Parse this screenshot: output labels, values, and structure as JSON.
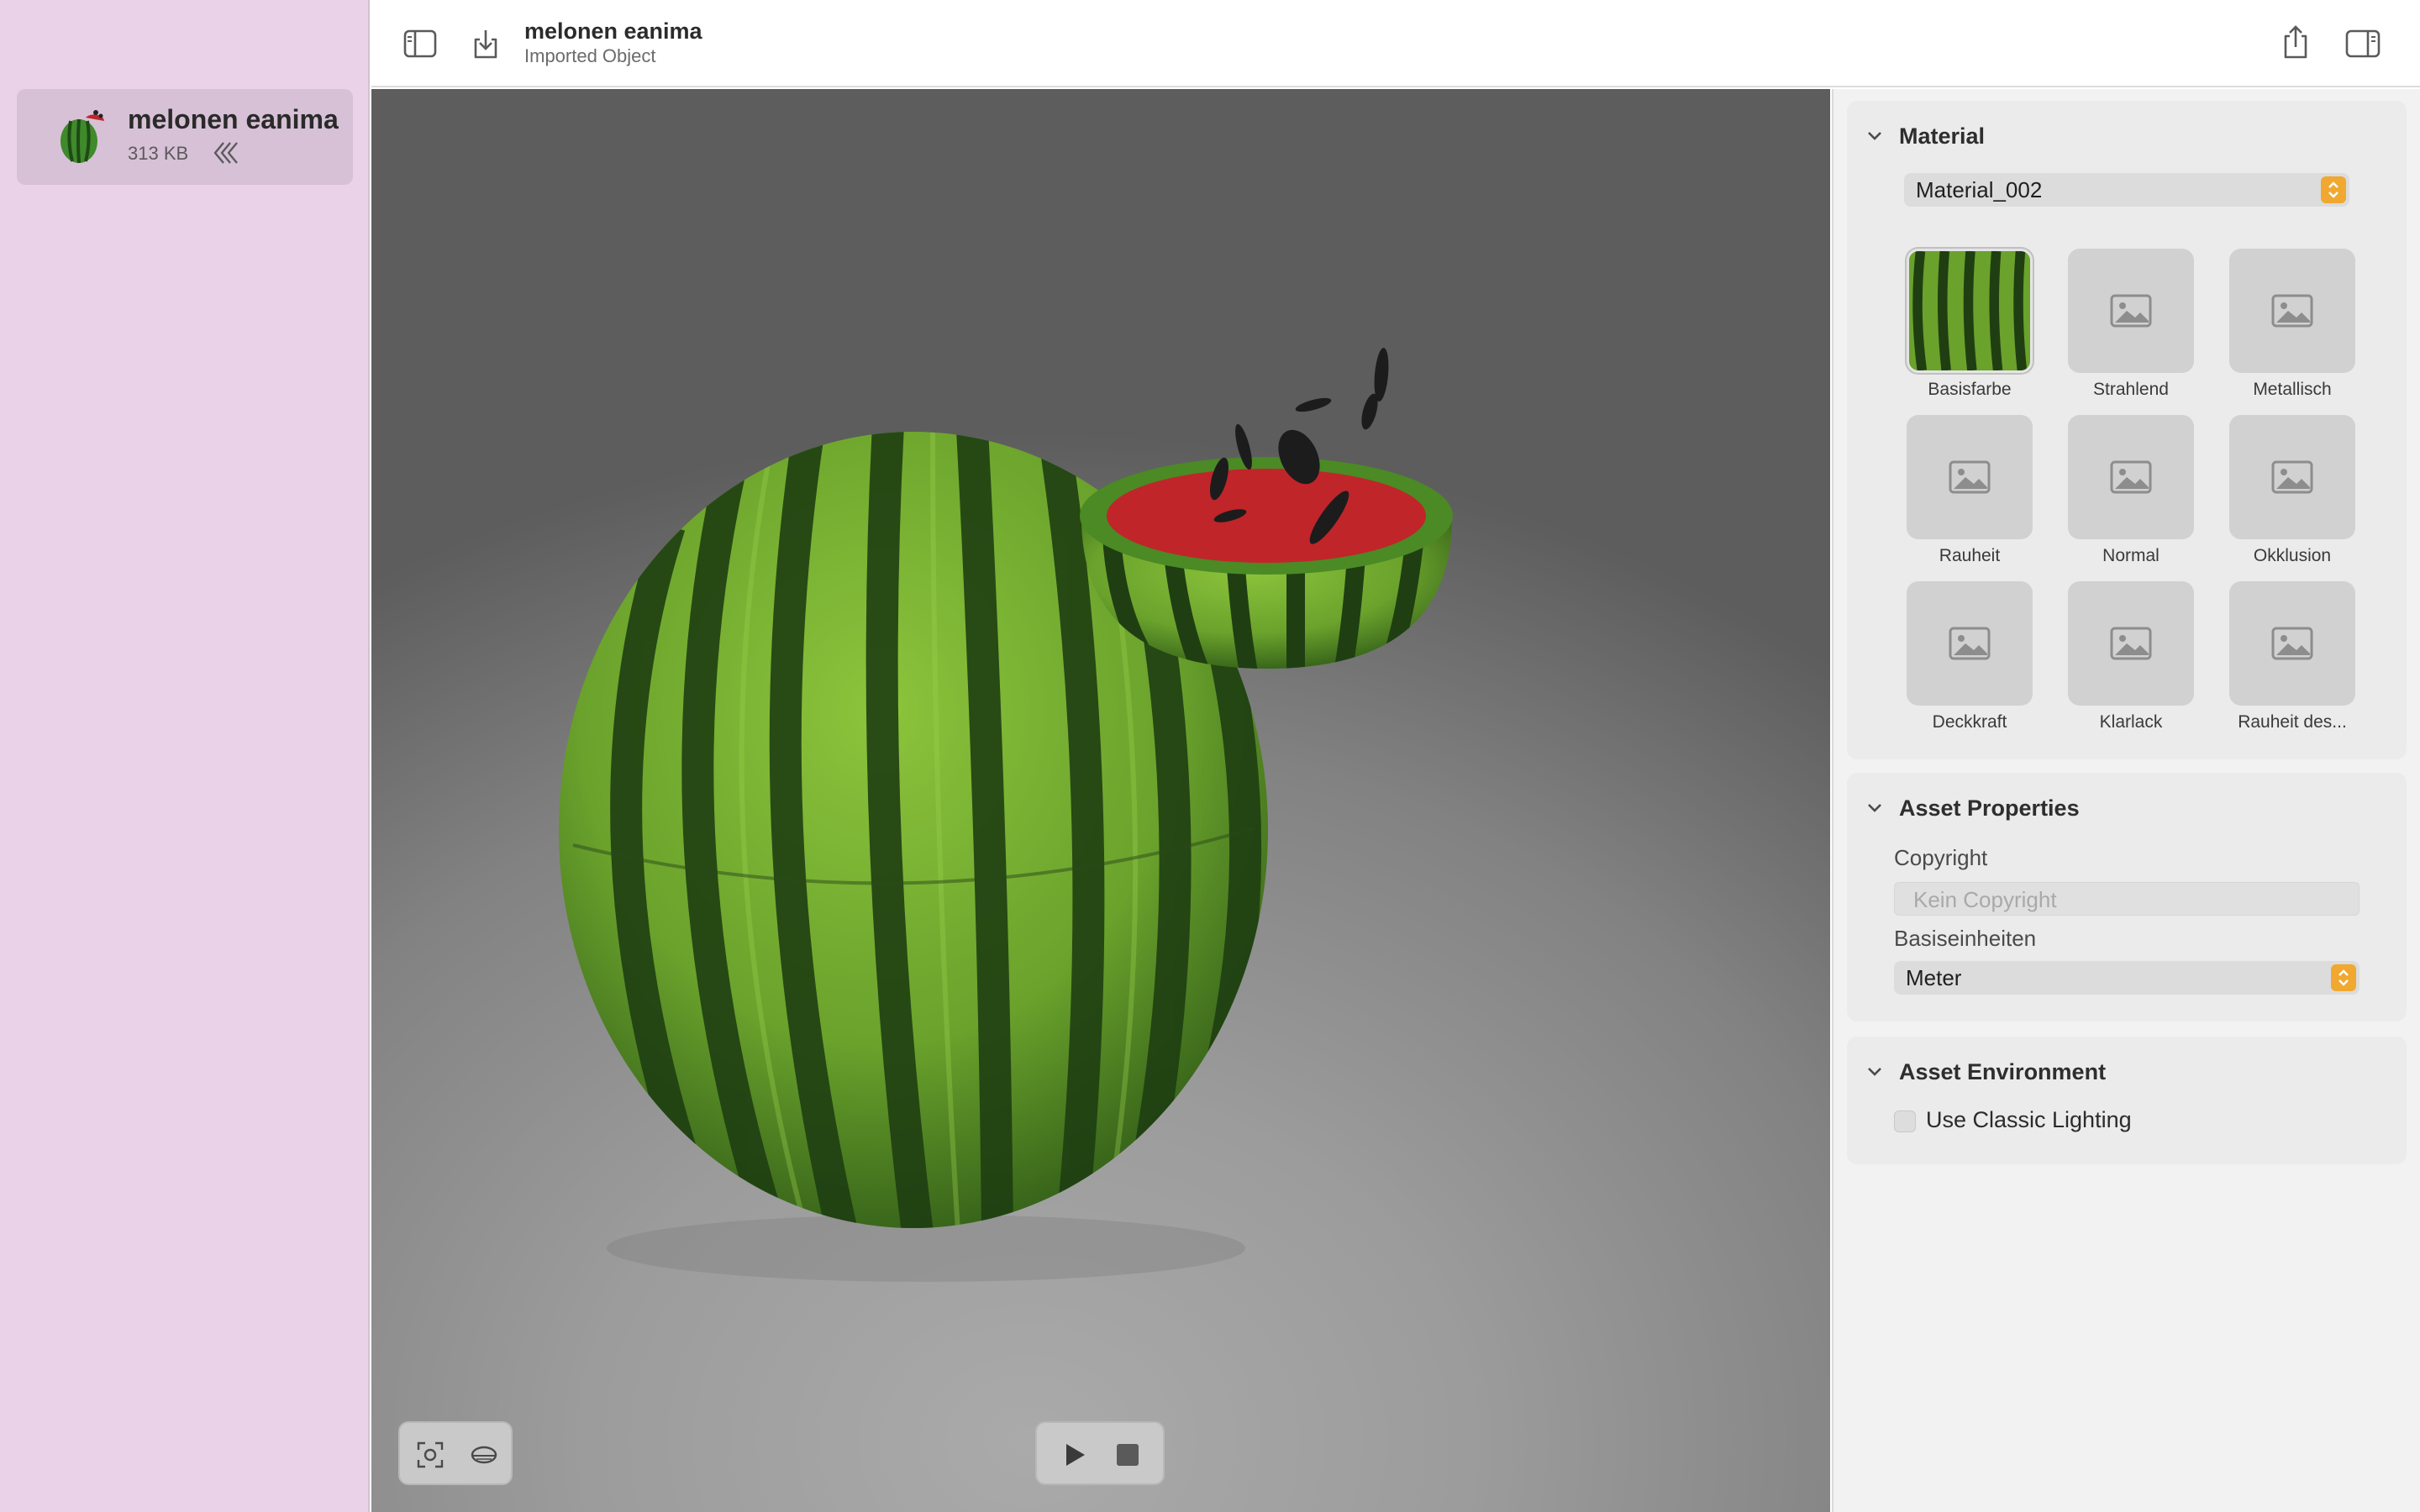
{
  "sidebar": {
    "file": {
      "name": "melonen eanima",
      "size": "313 KB"
    }
  },
  "toolbar": {
    "title": "melonen eanima",
    "subtitle": "Imported Object"
  },
  "inspector": {
    "material": {
      "title": "Material",
      "selected": "Material_002",
      "textures": [
        {
          "label": "Basisfarbe",
          "has_image": true
        },
        {
          "label": "Strahlend",
          "has_image": false
        },
        {
          "label": "Metallisch",
          "has_image": false
        },
        {
          "label": "Rauheit",
          "has_image": false
        },
        {
          "label": "Normal",
          "has_image": false
        },
        {
          "label": "Okklusion",
          "has_image": false
        },
        {
          "label": "Deckkraft",
          "has_image": false
        },
        {
          "label": "Klarlack",
          "has_image": false
        },
        {
          "label": "Rauheit des..."
        }
      ]
    },
    "asset_properties": {
      "title": "Asset Properties",
      "copyright_label": "Copyright",
      "copyright_placeholder": "Kein Copyright",
      "units_label": "Basiseinheiten",
      "units_value": "Meter"
    },
    "asset_environment": {
      "title": "Asset Environment",
      "classic_lighting_label": "Use Classic Lighting",
      "classic_lighting_checked": false
    }
  },
  "colors": {
    "sidebar_bg": "#ead3e8",
    "accent": "#f0a830",
    "melon_flesh": "#c0252a"
  }
}
